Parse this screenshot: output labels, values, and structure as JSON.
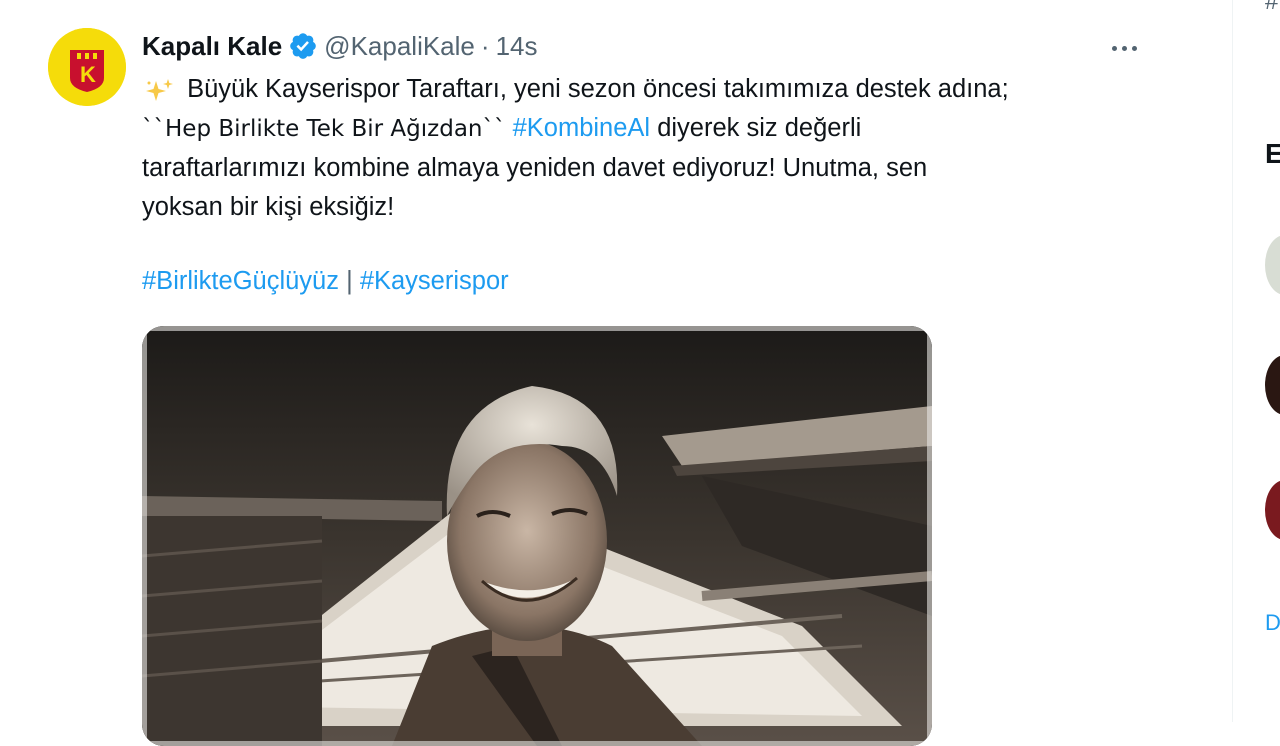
{
  "tweet": {
    "display_name": "Kapalı Kale",
    "handle": "@KapaliKale",
    "separator": "·",
    "time": "14s",
    "line1": "Büyük Kayserispor Taraftarı, yeni sezon öncesi takımımıza destek adına;",
    "quote": "``Hep Birlikte Tek Bir Ağızdan``",
    "hashtag_kombine": "#KombineAl",
    "line2_rest": "diyerek siz değerli",
    "line3": "taraftarlarımızı kombine almaya yeniden davet ediyoruz! Unutma, sen",
    "line4": "yoksan bir kişi eksiğiz!",
    "hashtag_birlikte": "#BirlikteGüçlüyüz",
    "pipe": "|",
    "hashtag_kayserispor": "#Kayserispor",
    "avatar_logo_text": "K",
    "icons": {
      "verified": "verified-badge-icon",
      "more": "more-options-icon",
      "sparkle": "sparkles-emoji-icon"
    }
  },
  "sidebar": {
    "partial_hash": "#",
    "partial_heading": "E",
    "partial_link": "D"
  },
  "colors": {
    "text": "#0f1419",
    "secondary": "#536471",
    "link": "#1d9bf0",
    "verified": "#1d9bf0",
    "avatar_bg": "#f5dc0a",
    "logo_red": "#c8102e"
  }
}
